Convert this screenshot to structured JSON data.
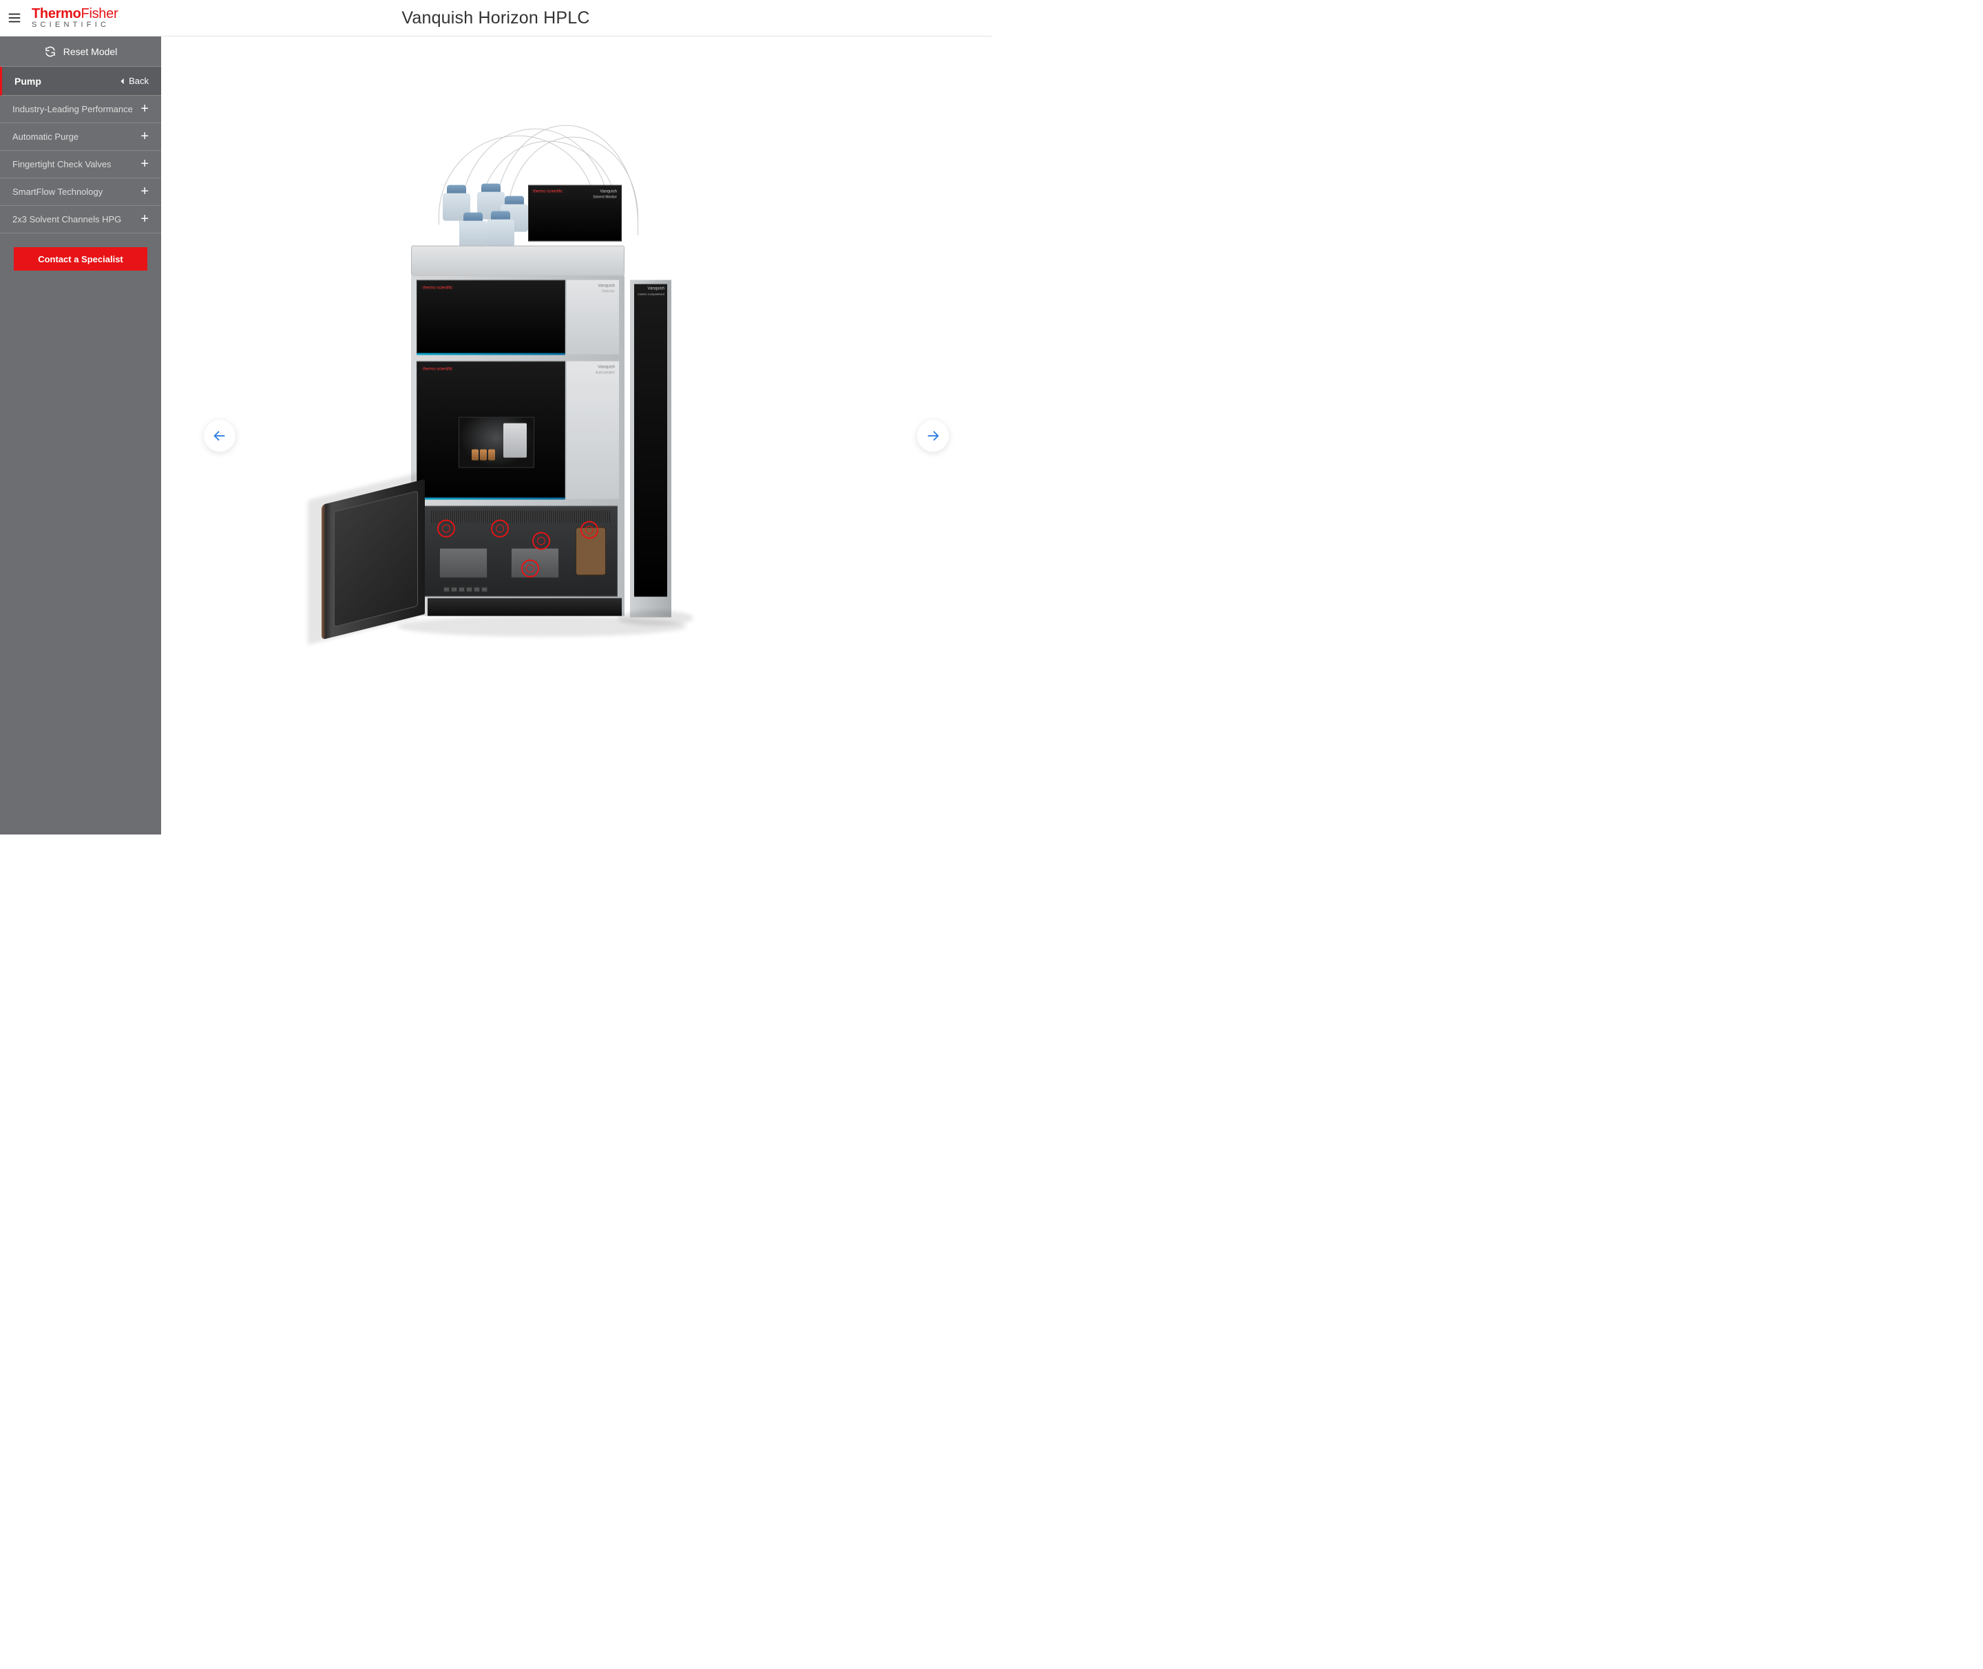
{
  "header": {
    "brand_top_1": "Thermo",
    "brand_top_2": "Fisher",
    "brand_bottom": "SCIENTIFIC",
    "title": "Vanquish Horizon HPLC"
  },
  "sidebar": {
    "reset_label": "Reset Model",
    "active_label": "Pump",
    "back_label": "Back",
    "items": [
      {
        "label": "Industry-Leading Performance"
      },
      {
        "label": "Automatic Purge"
      },
      {
        "label": "Fingertight Check Valves"
      },
      {
        "label": "SmartFlow Technology"
      },
      {
        "label": "2x3 Solvent Channels HPG"
      }
    ],
    "cta_label": "Contact a Specialist"
  },
  "labels": {
    "module_brand": "thermo scientific",
    "module_product": "Vanquish",
    "module_sub_solvent": "Solvent Monitor",
    "module_sub_detector": "Detector",
    "module_sub_sampler": "Autosampler",
    "module_sub_column": "Column Compartment"
  }
}
